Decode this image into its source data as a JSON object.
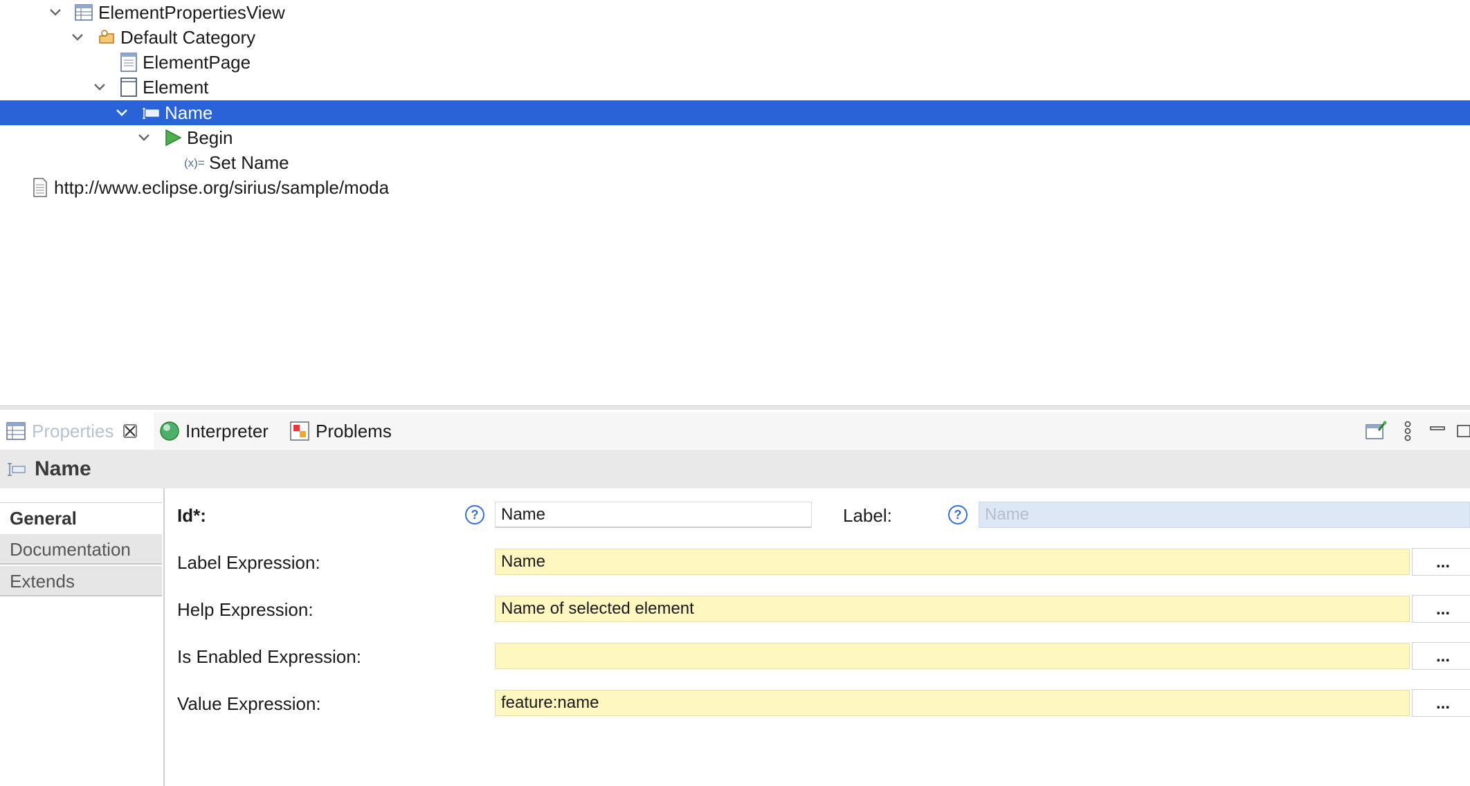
{
  "tree": {
    "items": [
      {
        "label": "ElementPropertiesView",
        "icon": "table-view-icon",
        "expanded": true
      },
      {
        "label": "Default Category",
        "icon": "category-icon",
        "expanded": true
      },
      {
        "label": "ElementPage",
        "icon": "page-icon"
      },
      {
        "label": "Element",
        "icon": "group-icon",
        "expanded": true
      },
      {
        "label": "Name",
        "icon": "text-widget-icon",
        "expanded": true,
        "selected": true
      },
      {
        "label": "Begin",
        "icon": "begin-icon",
        "expanded": true
      },
      {
        "label": "Set Name",
        "icon": "set-variable-icon"
      },
      {
        "label": "http://www.eclipse.org/sirius/sample/moda",
        "icon": "resource-file-icon"
      }
    ]
  },
  "tabs": [
    {
      "label": "Properties",
      "icon": "properties-icon",
      "active": true,
      "closable": true
    },
    {
      "label": "Interpreter",
      "icon": "interpreter-icon"
    },
    {
      "label": "Problems",
      "icon": "problems-icon"
    }
  ],
  "toolbar": {
    "icons": [
      "pin-editor-icon",
      "view-menu-icon",
      "minimize-icon",
      "maximize-icon"
    ]
  },
  "header": {
    "title": "Name",
    "icon": "text-widget-icon"
  },
  "sections": [
    "General",
    "Documentation",
    "Extends"
  ],
  "form": {
    "id_label": "Id*:",
    "id_value": "Name",
    "label_label": "Label:",
    "label_placeholder": "Name",
    "ellipsis": "...",
    "rows": [
      {
        "label": "Label Expression:",
        "value": "Name"
      },
      {
        "label": "Help Expression:",
        "value": "Name of selected element"
      },
      {
        "label": "Is Enabled Expression:",
        "value": ""
      },
      {
        "label": "Value Expression:",
        "value": "feature:name"
      }
    ]
  },
  "colors": {
    "selection": "#2a62d8",
    "expression_field": "#fff6c0",
    "disabled_field": "#dde7f5"
  }
}
